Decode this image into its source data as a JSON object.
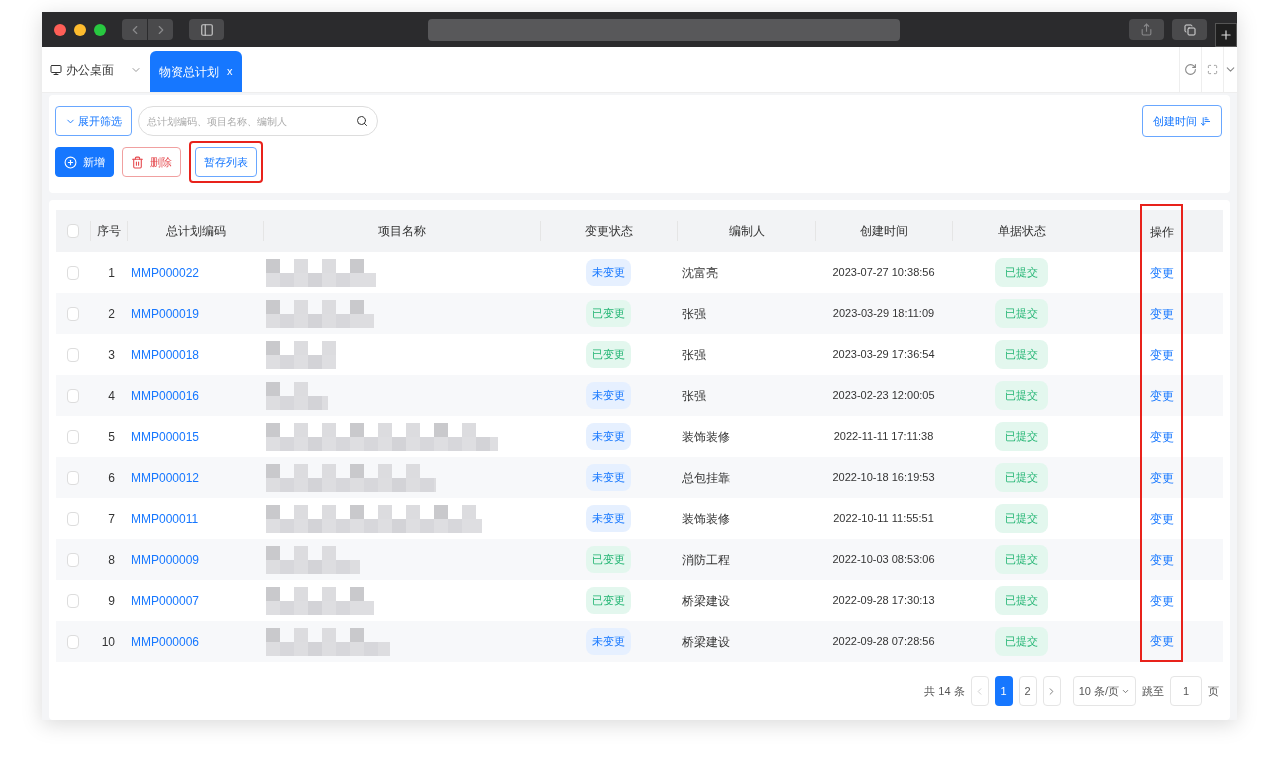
{
  "tabs": [
    {
      "label": "办公桌面",
      "selected": false
    },
    {
      "label": "物资总计划",
      "selected": true,
      "close": "x"
    }
  ],
  "filter": {
    "expand_button": "展开筛选",
    "search": {
      "placeholder": "总计划编码、项目名称、编制人"
    },
    "sort_button": "创建时间"
  },
  "actions": [
    {
      "label": "新增",
      "kind": "primary",
      "highlighted": false
    },
    {
      "label": "删除",
      "kind": "danger",
      "highlighted": false
    },
    {
      "label": "暂存列表",
      "kind": "outline",
      "highlighted": true
    }
  ],
  "table": {
    "header_checked": false,
    "columns": [
      {
        "label": "序号",
        "highlighted": false
      },
      {
        "label": "总计划编码",
        "highlighted": false
      },
      {
        "label": "项目名称",
        "highlighted": false
      },
      {
        "label": "变更状态",
        "highlighted": false
      },
      {
        "label": "编制人",
        "highlighted": false
      },
      {
        "label": "创建时间",
        "highlighted": false
      },
      {
        "label": "单据状态",
        "highlighted": false
      },
      {
        "label": "操作",
        "highlighted": true
      }
    ],
    "rows": [
      {
        "checked": false,
        "index": "1",
        "code": "MMP000022",
        "change_status": {
          "label": "未变更",
          "kind": "unchanged"
        },
        "editor": "沈富亮",
        "created": "2023-07-27 10:38:56",
        "doc_status": "已提交",
        "action": "变更"
      },
      {
        "checked": false,
        "index": "2",
        "code": "MMP000019",
        "change_status": {
          "label": "已变更",
          "kind": "changed"
        },
        "editor": "张强",
        "created": "2023-03-29 18:11:09",
        "doc_status": "已提交",
        "action": "变更"
      },
      {
        "checked": false,
        "index": "3",
        "code": "MMP000018",
        "change_status": {
          "label": "已变更",
          "kind": "changed"
        },
        "editor": "张强",
        "created": "2023-03-29 17:36:54",
        "doc_status": "已提交",
        "action": "变更"
      },
      {
        "checked": false,
        "index": "4",
        "code": "MMP000016",
        "change_status": {
          "label": "未变更",
          "kind": "unchanged"
        },
        "editor": "张强",
        "created": "2023-02-23 12:00:05",
        "doc_status": "已提交",
        "action": "变更"
      },
      {
        "checked": false,
        "index": "5",
        "code": "MMP000015",
        "change_status": {
          "label": "未变更",
          "kind": "unchanged"
        },
        "editor": "装饰装修",
        "created": "2022-11-11 17:11:38",
        "doc_status": "已提交",
        "action": "变更"
      },
      {
        "checked": false,
        "index": "6",
        "code": "MMP000012",
        "change_status": {
          "label": "未变更",
          "kind": "unchanged"
        },
        "editor": "总包挂靠",
        "created": "2022-10-18 16:19:53",
        "doc_status": "已提交",
        "action": "变更"
      },
      {
        "checked": false,
        "index": "7",
        "code": "MMP000011",
        "change_status": {
          "label": "未变更",
          "kind": "unchanged"
        },
        "editor": "装饰装修",
        "created": "2022-10-11 11:55:51",
        "doc_status": "已提交",
        "action": "变更"
      },
      {
        "checked": false,
        "index": "8",
        "code": "MMP000009",
        "change_status": {
          "label": "已变更",
          "kind": "changed"
        },
        "editor": "消防工程",
        "created": "2022-10-03 08:53:06",
        "doc_status": "已提交",
        "action": "变更"
      },
      {
        "checked": false,
        "index": "9",
        "code": "MMP000007",
        "change_status": {
          "label": "已变更",
          "kind": "changed"
        },
        "editor": "桥梁建设",
        "created": "2022-09-28 17:30:13",
        "doc_status": "已提交",
        "action": "变更"
      },
      {
        "checked": false,
        "index": "10",
        "code": "MMP000006",
        "change_status": {
          "label": "未变更",
          "kind": "unchanged"
        },
        "editor": "桥梁建设",
        "created": "2022-09-28 07:28:56",
        "doc_status": "已提交",
        "action": "变更"
      }
    ]
  },
  "pagination": {
    "total": "共 14 条",
    "pages": [
      {
        "label": "1",
        "selected": true
      },
      {
        "label": "2",
        "selected": false
      }
    ],
    "page_size": "10 条/页",
    "jump_label": "跳至",
    "jump_value": "1",
    "jump_suffix": "页"
  }
}
